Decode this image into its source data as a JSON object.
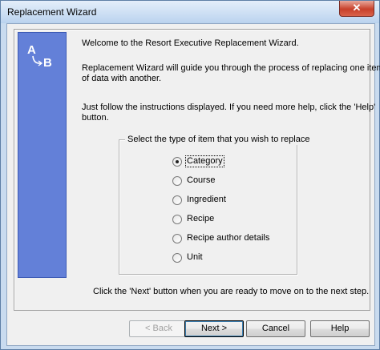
{
  "window": {
    "title": "Replacement Wizard",
    "close_glyph": "✕"
  },
  "logo": {
    "icon": "ab-replace-icon"
  },
  "intro": {
    "welcome": "Welcome to the Resort Executive Replacement Wizard.",
    "line2a": "Replacement Wizard will guide you through the process of replacing one item",
    "line2b": "of data with another.",
    "line3a": "Just follow the instructions displayed.  If you need more help, click the 'Help'",
    "line3b": "button."
  },
  "group": {
    "legend": "Select the type of item that you wish to replace",
    "options": [
      {
        "label": "Category",
        "checked": true
      },
      {
        "label": "Course",
        "checked": false
      },
      {
        "label": "Ingredient",
        "checked": false
      },
      {
        "label": "Recipe",
        "checked": false
      },
      {
        "label": "Recipe author details",
        "checked": false
      },
      {
        "label": "Unit",
        "checked": false
      }
    ]
  },
  "footer_text": "Click the 'Next' button when you are ready to move on to the next step.",
  "buttons": {
    "back": "< Back",
    "next": "Next >",
    "cancel": "Cancel",
    "help": "Help"
  }
}
